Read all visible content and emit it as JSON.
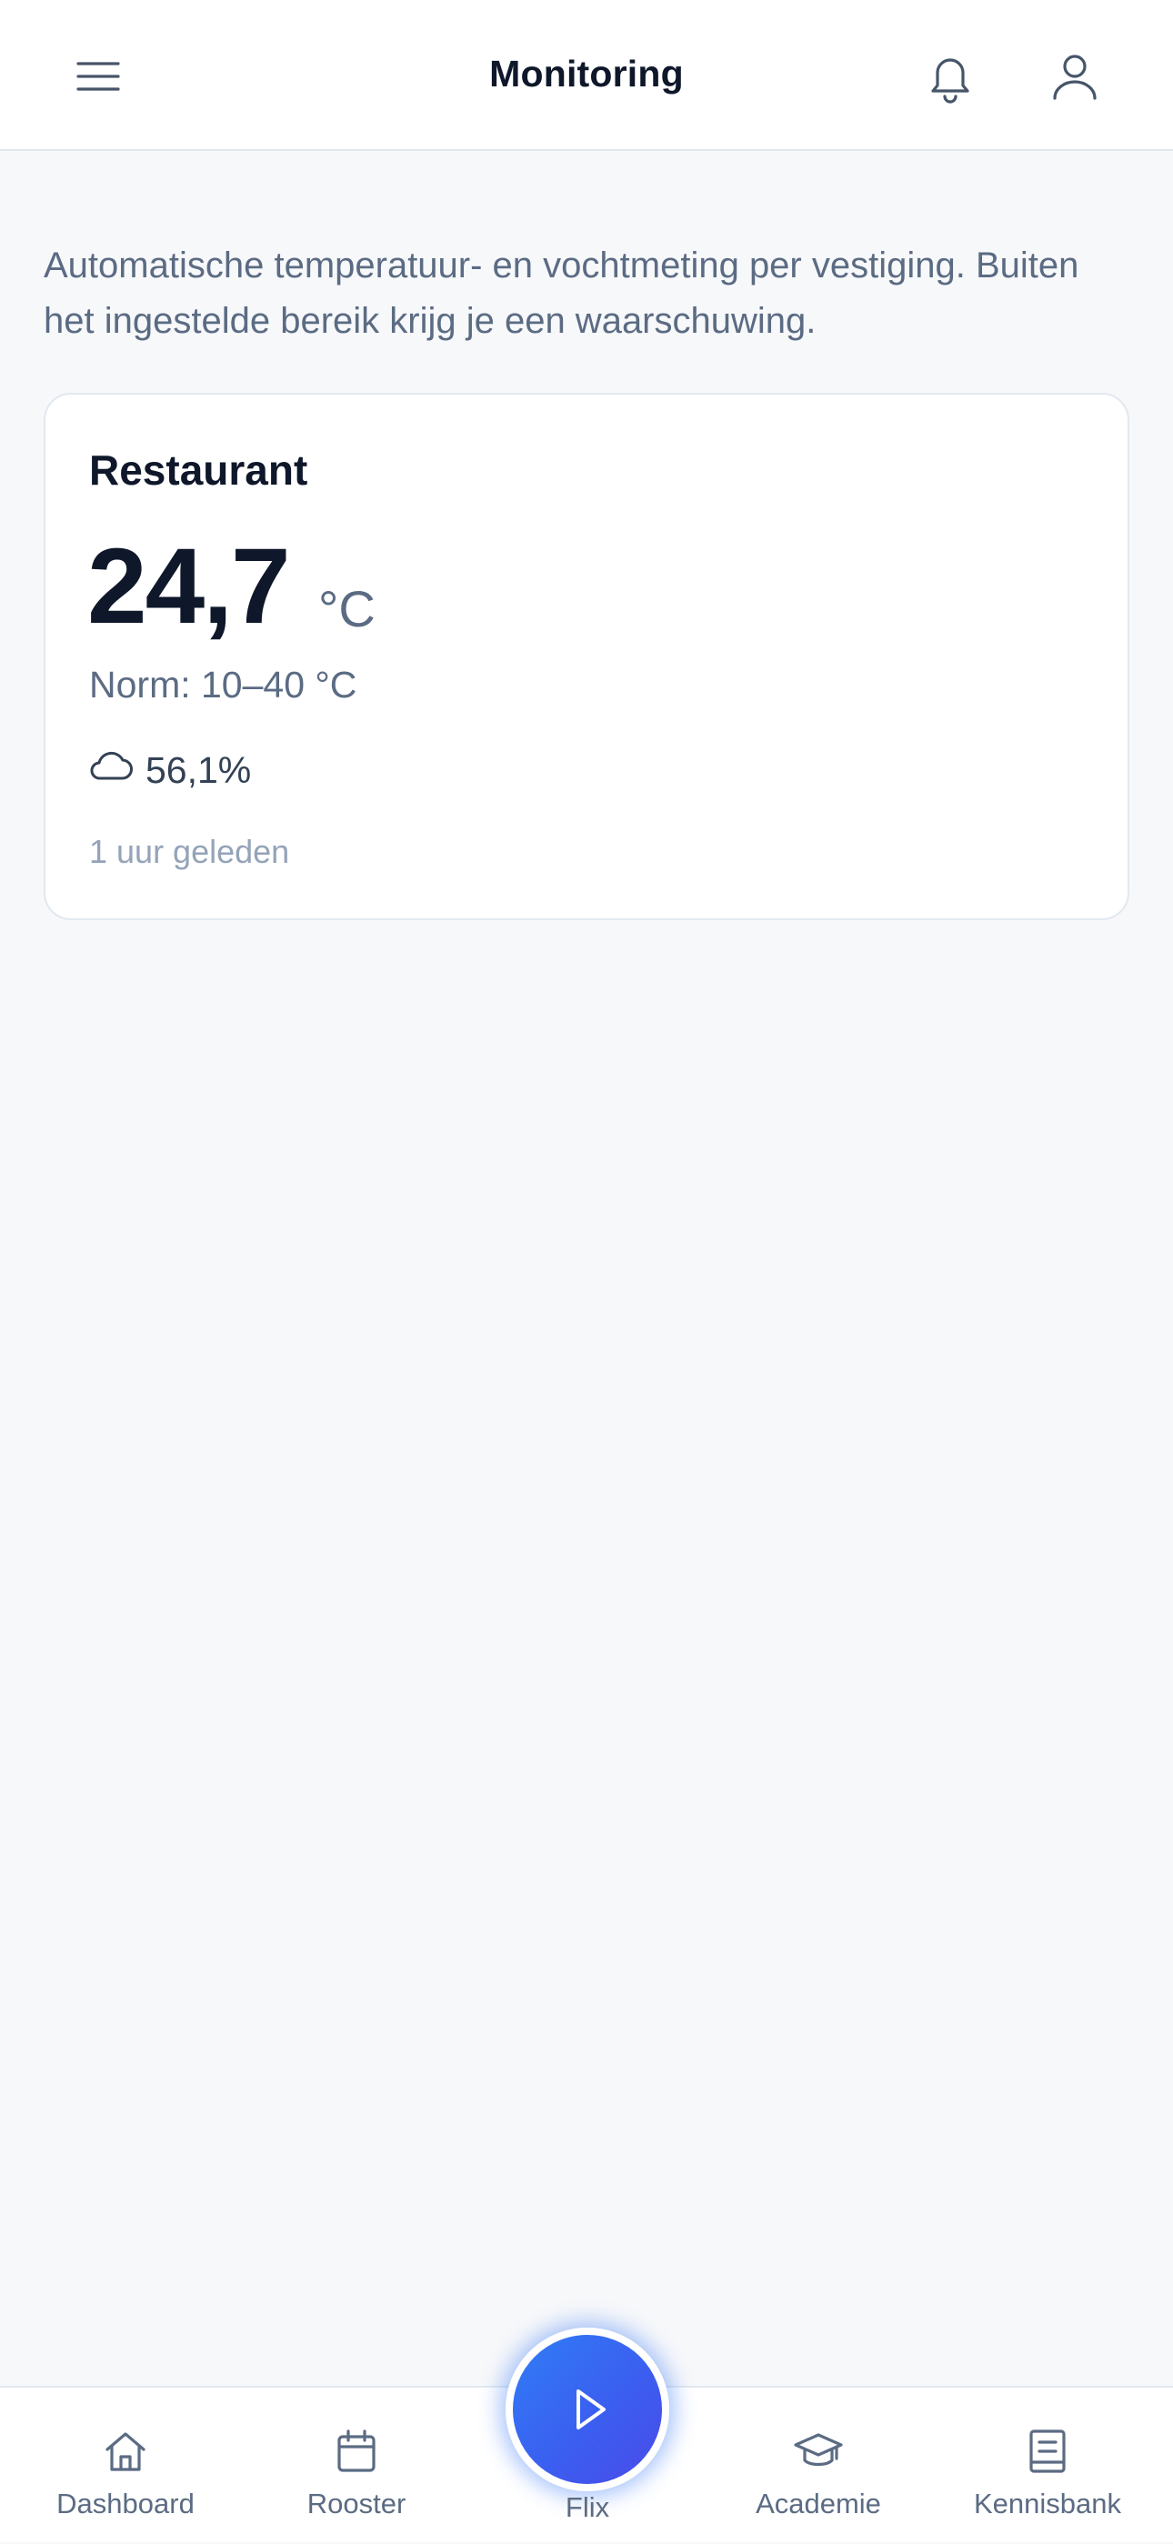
{
  "header": {
    "title": "Monitoring",
    "menu_icon": "hamburger-icon",
    "notifications_icon": "bell-icon",
    "profile_icon": "user-icon"
  },
  "intro": {
    "text": "Automatische temperatuur- en vochtmeting per vestiging. Buiten het ingestelde bereik krijg je een waarschuwing."
  },
  "sensor": {
    "location": "Restaurant",
    "temperature": "24,7",
    "unit": "°C",
    "norm": "Norm: 10–40 °C",
    "humidity_icon": "cloud-icon",
    "humidity": "56,1%",
    "updated": "1 uur geleden"
  },
  "nav": {
    "items": [
      {
        "label": "Dashboard",
        "icon": "home-icon"
      },
      {
        "label": "Rooster",
        "icon": "calendar-icon"
      },
      {
        "label": "Flix",
        "icon": "play-icon"
      },
      {
        "label": "Academie",
        "icon": "graduation-cap-icon"
      },
      {
        "label": "Kennisbank",
        "icon": "book-icon"
      }
    ]
  },
  "colors": {
    "accent": "#3b5ff0",
    "text_primary": "#0f172a",
    "text_secondary": "#5b6b83",
    "muted": "#94a3b8",
    "background": "#f7f8fa"
  }
}
